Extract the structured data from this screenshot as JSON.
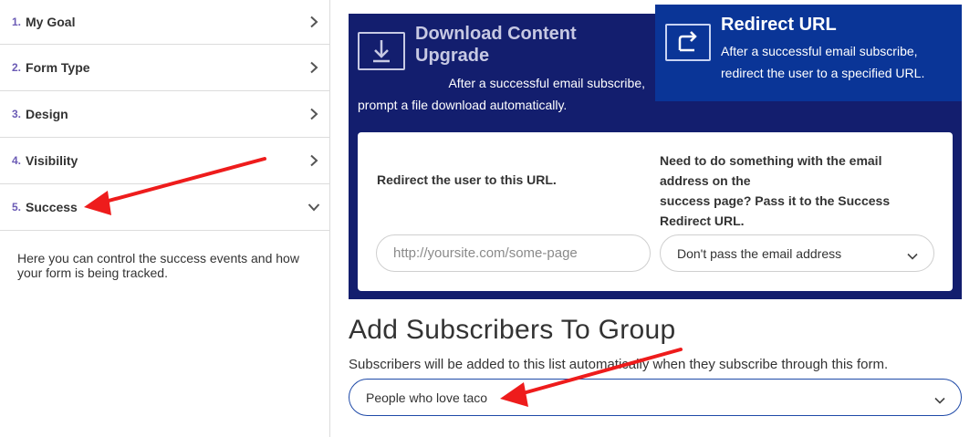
{
  "sidebar": {
    "steps": [
      {
        "num": "1.",
        "label": "My Goal"
      },
      {
        "num": "2.",
        "label": "Form Type"
      },
      {
        "num": "3.",
        "label": "Design"
      },
      {
        "num": "4.",
        "label": "Visibility"
      },
      {
        "num": "5.",
        "label": "Success"
      }
    ],
    "description": "Here you can control the success events and how your form is being tracked."
  },
  "options": {
    "download": {
      "title": "Download Content Upgrade",
      "desc_line1": "After a successful email subscribe,",
      "desc_line2": "prompt a file download automatically."
    },
    "redirect": {
      "title": "Redirect URL",
      "desc": "After a successful email subscribe, redirect the user to a specified URL."
    }
  },
  "redirect_form": {
    "url_label": "Redirect the user to this URL.",
    "pass_label_line1": "Need to do something with the email",
    "pass_label_line2": "address on the",
    "pass_label_line3": "success page? Pass it to the Success",
    "pass_label_line4": "Redirect URL.",
    "url_placeholder": "http://yoursite.com/some-page",
    "pass_selected": "Don't pass the email address"
  },
  "group": {
    "title": "Add Subscribers To Group",
    "desc": "Subscribers will be added to this list automatically when they subscribe through this form.",
    "selected": "People who love taco"
  },
  "colors": {
    "panel_bg": "#131e6e",
    "redirect_active_bg": "#0a3597",
    "step_number": "#6b5bb5",
    "annotation_arrow": "#ee1c1c"
  }
}
